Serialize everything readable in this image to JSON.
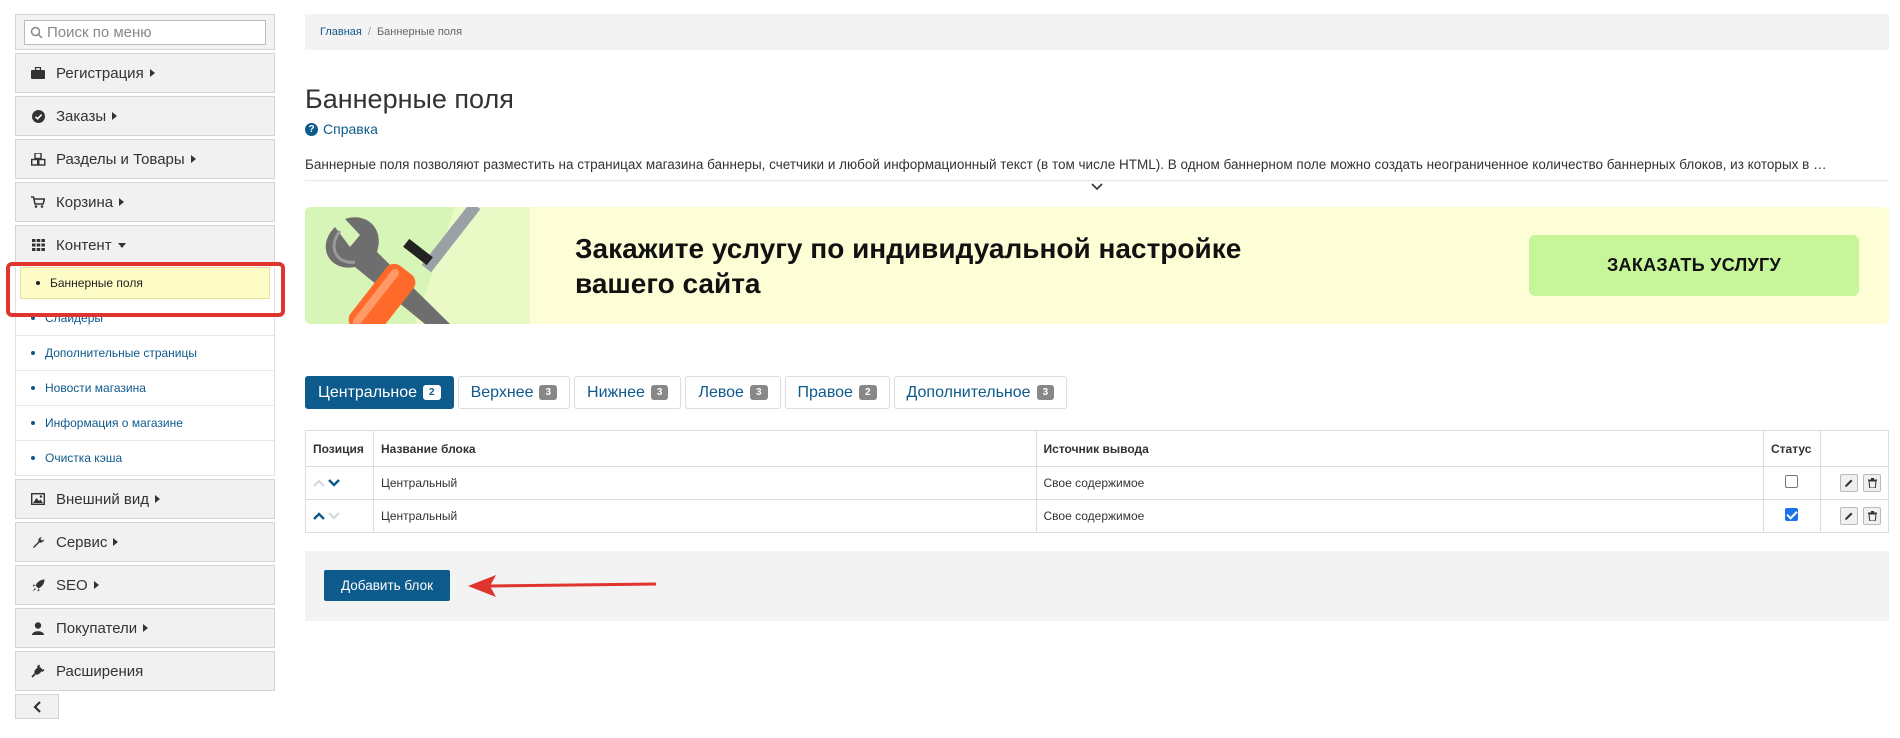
{
  "sidebar": {
    "search_placeholder": "Поиск по меню",
    "items": [
      {
        "label": "Регистрация",
        "icon": "briefcase-icon"
      },
      {
        "label": "Заказы",
        "icon": "check-circle-icon"
      },
      {
        "label": "Разделы и Товары",
        "icon": "cubes-icon"
      },
      {
        "label": "Корзина",
        "icon": "cart-icon"
      },
      {
        "label": "Контент",
        "icon": "grid-icon"
      }
    ],
    "content_sub": [
      "Баннерные поля",
      "Слайдеры",
      "Дополнительные страницы",
      "Новости магазина",
      "Информация о магазине",
      "Очистка кэша"
    ],
    "items_after": [
      {
        "label": "Внешний вид",
        "icon": "image-icon"
      },
      {
        "label": "Сервис",
        "icon": "wrench-icon"
      },
      {
        "label": "SEO",
        "icon": "rocket-icon"
      },
      {
        "label": "Покупатели",
        "icon": "user-icon"
      },
      {
        "label": "Расширения",
        "icon": "plug-icon"
      }
    ]
  },
  "breadcrumb": {
    "home": "Главная",
    "current": "Баннерные поля"
  },
  "page": {
    "title": "Баннерные поля",
    "help": "Справка",
    "description": "Баннерные поля позволяют разместить на страницах магазина баннеры, счетчики и любой информационный текст (в том числе HTML). В одном баннерном поле можно создать неограниченное количество баннерных блоков, из которых в …"
  },
  "banner": {
    "text_line1": "Закажите услугу по индивидуальной настройке",
    "text_line2": "вашего сайта",
    "button": "ЗАКАЗАТЬ УСЛУГУ"
  },
  "tabs": [
    {
      "label": "Центральное",
      "count": "2"
    },
    {
      "label": "Верхнее",
      "count": "3"
    },
    {
      "label": "Нижнее",
      "count": "3"
    },
    {
      "label": "Левое",
      "count": "3"
    },
    {
      "label": "Правое",
      "count": "2"
    },
    {
      "label": "Дополнительное",
      "count": "3"
    }
  ],
  "table": {
    "headers": {
      "position": "Позиция",
      "name": "Название блока",
      "source": "Источник вывода",
      "status": "Статус"
    },
    "rows": [
      {
        "name": "Центральный",
        "source": "Свое содержимое",
        "status": false
      },
      {
        "name": "Центральный",
        "source": "Свое содержимое",
        "status": true
      }
    ]
  },
  "footer": {
    "add_button": "Добавить блок"
  },
  "colors": {
    "accent": "#0d5a8c",
    "highlight": "#e0342f",
    "banner_bg": "#fdfed6",
    "banner_btn": "#c7f59a"
  }
}
